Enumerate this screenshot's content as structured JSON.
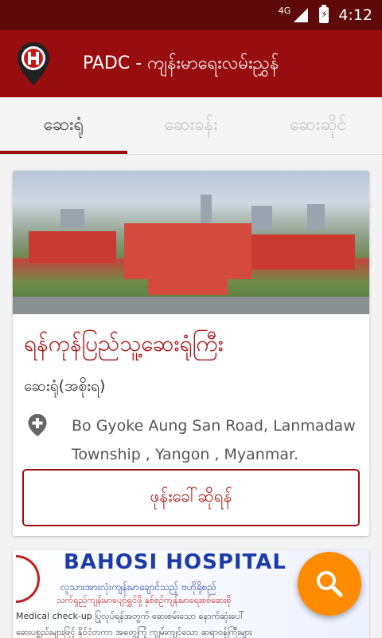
{
  "status_bar": {
    "network": "4G",
    "time": "4:12"
  },
  "app_bar": {
    "title": "PADC - ကျန်းမာရေးလမ်းညွှန်"
  },
  "tabs": [
    {
      "label": "ဆေးရုံ",
      "active": true
    },
    {
      "label": "ဆေးခန်း",
      "active": false
    },
    {
      "label": "ဆေးဆိုင်",
      "active": false
    }
  ],
  "hospital_card": {
    "name": "ရန်ကုန်ပြည်သူ့ဆေးရုံကြီး",
    "type": "ဆေးရုံ(အစိုးရ)",
    "address": "Bo Gyoke Aung San Road, Lanmadaw Township , Yangon , Myanmar.",
    "call_label": "ဖုန်းခေါ်ဆိုရန်"
  },
  "next_card": {
    "banner_title": "BAHOSI HOSPITAL",
    "line1": "လူသားအားလုံးကျန်းမာချောင်သည့် ဗဟိုရိုစည်",
    "line2": "သက်ရှည်ကျန်းမာပျော်ရွှင်ဖို့ နှစ်စဉ်ကျန်းမာရေးစစ်ဆေးစို",
    "line3": "Medical check-up  ပြုလုပ်ရန်အတွက် ဆေးစမ်းသော နောက်ဆုံးပေါ်",
    "line4": "ဆေးပစ္စည်းများဖြင့် နိုင်ငံတကာ အတွေ့ကြုံ ကျွမ်းကျင်သော ဆရာဝန်ကြီးများ"
  },
  "fab": {
    "icon": "search-icon"
  },
  "colors": {
    "primary": "#980e0e",
    "status": "#5e0a0a",
    "accent": "#ff8c00"
  }
}
